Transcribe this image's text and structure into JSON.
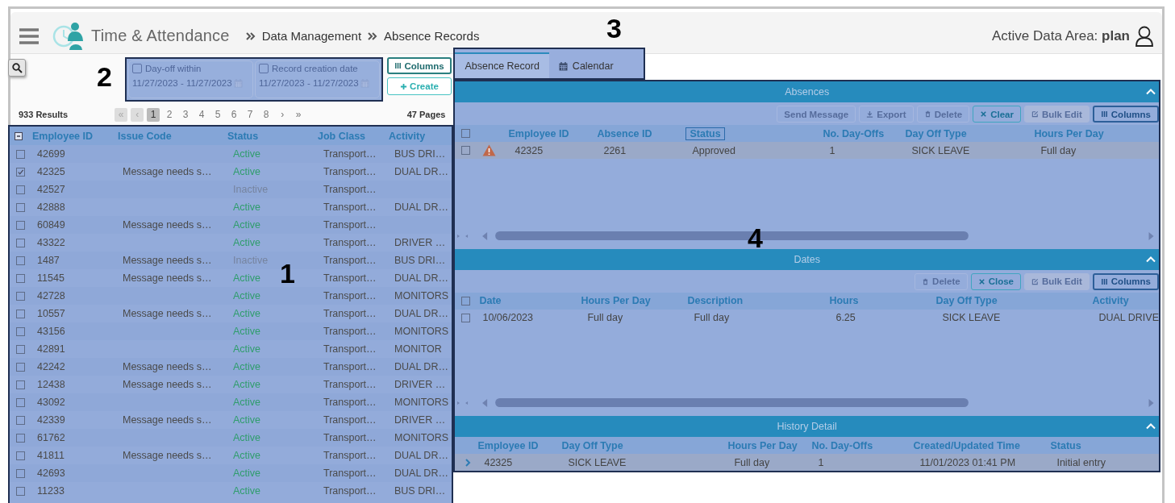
{
  "header": {
    "app_name": "Time & Attendance",
    "breadcrumbs": [
      "Data Management",
      "Absence Records"
    ],
    "data_area": "Active Data Area: **plan**"
  },
  "filters": [
    {
      "label": "Day-off within",
      "checked": false,
      "range": "11/27/2023 - 11/27/2023"
    },
    {
      "label": "Record creation date",
      "checked": false,
      "range": "11/27/2023 - 11/27/2023"
    }
  ],
  "filter_buttons": [
    {
      "kind": "columns",
      "label": "Columns"
    },
    {
      "kind": "create",
      "label": "Create"
    }
  ],
  "results": "933 Results",
  "pages": "47 Pages",
  "pagination": [
    {
      "label": "«",
      "disabled": true,
      "selected": false
    },
    {
      "label": "‹",
      "disabled": true,
      "selected": false
    },
    {
      "label": "1",
      "disabled": false,
      "selected": true
    },
    {
      "label": "2",
      "disabled": false,
      "selected": false
    },
    {
      "label": "3",
      "disabled": false,
      "selected": false
    },
    {
      "label": "4",
      "disabled": false,
      "selected": false
    },
    {
      "label": "5",
      "disabled": false,
      "selected": false
    },
    {
      "label": "6",
      "disabled": false,
      "selected": false
    },
    {
      "label": "7",
      "disabled": false,
      "selected": false
    },
    {
      "label": "8",
      "disabled": false,
      "selected": false
    },
    {
      "label": "›",
      "disabled": false,
      "selected": false
    },
    {
      "label": "»",
      "disabled": false,
      "selected": false
    }
  ],
  "employees": {
    "columns": [
      "Employee ID",
      "Issue Code",
      "Status",
      "Job Class",
      "Activity"
    ],
    "rows": [
      {
        "checked": false,
        "employee_id": "42699",
        "status": "Active",
        "active": true,
        "job_class": "Transport…",
        "activity": "BUS DRI…"
      },
      {
        "checked": true,
        "employee_id": "42325",
        "issue_code": "Message needs s…",
        "status": "Active",
        "active": true,
        "job_class": "Transport…",
        "activity": "DUAL DR…"
      },
      {
        "checked": false,
        "employee_id": "42527",
        "status": "Inactive",
        "active": false,
        "job_class": "Transport…"
      },
      {
        "checked": false,
        "employee_id": "42888",
        "status": "Active",
        "active": true,
        "job_class": "Transport…",
        "activity": "DUAL DR…"
      },
      {
        "checked": false,
        "employee_id": "60849",
        "issue_code": "Message needs s…",
        "status": "Active",
        "active": true,
        "job_class": "Transport…"
      },
      {
        "checked": false,
        "employee_id": "43322",
        "status": "Active",
        "active": true,
        "job_class": "Transport…",
        "activity": "DRIVER …"
      },
      {
        "checked": false,
        "employee_id": "1487",
        "issue_code": "Message needs s…",
        "status": "Inactive",
        "active": false,
        "job_class": "Transport…",
        "activity": "BUS DRI…"
      },
      {
        "checked": false,
        "employee_id": "11545",
        "issue_code": "Message needs s…",
        "status": "Active",
        "active": true,
        "job_class": "Transport…",
        "activity": "DUAL DR…"
      },
      {
        "checked": false,
        "employee_id": "42728",
        "status": "Active",
        "active": true,
        "job_class": "Transport…",
        "activity": "MONITORS"
      },
      {
        "checked": false,
        "employee_id": "10557",
        "issue_code": "Message needs s…",
        "status": "Active",
        "active": true,
        "job_class": "Transport…",
        "activity": "DUAL DR…"
      },
      {
        "checked": false,
        "employee_id": "43156",
        "status": "Active",
        "active": true,
        "job_class": "Transport…",
        "activity": "MONITORS"
      },
      {
        "checked": false,
        "employee_id": "42891",
        "status": "Active",
        "active": true,
        "job_class": "Transport…",
        "activity": "MONITOR"
      },
      {
        "checked": false,
        "employee_id": "42242",
        "issue_code": "Message needs s…",
        "status": "Active",
        "active": true,
        "job_class": "Transport…",
        "activity": "DUAL DR…"
      },
      {
        "checked": false,
        "employee_id": "12438",
        "issue_code": "Message needs s…",
        "status": "Active",
        "active": true,
        "job_class": "Transport…",
        "activity": "DRIVER …"
      },
      {
        "checked": false,
        "employee_id": "43092",
        "status": "Active",
        "active": true,
        "job_class": "Transport…",
        "activity": "MONITORS"
      },
      {
        "checked": false,
        "employee_id": "42339",
        "issue_code": "Message needs s…",
        "status": "Active",
        "active": true,
        "job_class": "Transport…",
        "activity": "DRIVER …"
      },
      {
        "checked": false,
        "employee_id": "61762",
        "status": "Active",
        "active": true,
        "job_class": "Transport…",
        "activity": "MONITORS"
      },
      {
        "checked": false,
        "employee_id": "41811",
        "issue_code": "Message needs s…",
        "status": "Active",
        "active": true,
        "job_class": "Transport…",
        "activity": "DUAL DR…"
      },
      {
        "checked": false,
        "employee_id": "42693",
        "status": "Active",
        "active": true,
        "job_class": "Transport…",
        "activity": "DUAL DR…"
      },
      {
        "checked": false,
        "employee_id": "11233",
        "status": "Active",
        "active": true,
        "job_class": "Transport…",
        "activity": "BUS DRI…"
      }
    ]
  },
  "tabs": [
    {
      "label": "Absence Record",
      "kind": "plain",
      "selected": true
    },
    {
      "label": "Calendar",
      "kind": "calendar",
      "selected": false
    }
  ],
  "absences": {
    "title": "Absences",
    "all_checked": false,
    "buttons": [
      {
        "kind": "send",
        "label": "Send Message",
        "disabled": true
      },
      {
        "kind": "export",
        "label": "Export",
        "disabled": true
      },
      {
        "kind": "delete",
        "label": "Delete",
        "disabled": true
      },
      {
        "kind": "clear",
        "label": "Clear",
        "disabled": false
      },
      {
        "kind": "edit",
        "label": "Bulk Edit",
        "disabled": true
      },
      {
        "kind": "columns",
        "label": "Columns",
        "disabled": false
      }
    ],
    "columns": [
      {
        "label": "Employee ID",
        "focused": false
      },
      {
        "label": "Absence ID",
        "focused": false
      },
      {
        "label": "Status",
        "focused": true
      },
      {
        "label": "No. Day-Offs",
        "focused": false
      },
      {
        "label": "Day Off Type",
        "focused": false
      },
      {
        "label": "Hours Per Day",
        "focused": false
      }
    ],
    "rows": [
      {
        "checked": false,
        "warning": true,
        "selected": true,
        "cells": [
          "42325",
          "2261",
          "Approved",
          "1",
          "SICK LEAVE",
          "Full day"
        ]
      }
    ]
  },
  "dates": {
    "title": "Dates",
    "all_checked": false,
    "buttons": [
      {
        "kind": "delete",
        "label": "Delete",
        "disabled": true
      },
      {
        "kind": "clear",
        "label": "Close",
        "disabled": false
      },
      {
        "kind": "edit",
        "label": "Bulk Edit",
        "disabled": true
      },
      {
        "kind": "columns",
        "label": "Columns",
        "disabled": false
      }
    ],
    "columns": [
      "Date",
      "Hours Per Day",
      "Description",
      "Hours",
      "Day Off Type",
      "Activity"
    ],
    "rows": [
      {
        "checked": false,
        "selected": false,
        "cells": [
          "10/06/2023",
          "Full day",
          "Full day",
          "6.25",
          "SICK LEAVE",
          "DUAL DRIVE"
        ]
      }
    ]
  },
  "history": {
    "title": "History Detail",
    "columns": [
      "Employee ID",
      "Day Off Type",
      "Hours Per Day",
      "No. Day-Offs",
      "Created/Updated Time",
      "Status"
    ],
    "rows": [
      {
        "expanded": false,
        "selected": true,
        "cells": [
          "42325",
          "SICK LEAVE",
          "Full day",
          "1",
          "11/01/2023 01:41 PM",
          "Initial entry"
        ]
      }
    ]
  },
  "annotations": [
    {
      "label": "1"
    },
    {
      "label": "2"
    },
    {
      "label": "3"
    },
    {
      "label": "4"
    }
  ]
}
